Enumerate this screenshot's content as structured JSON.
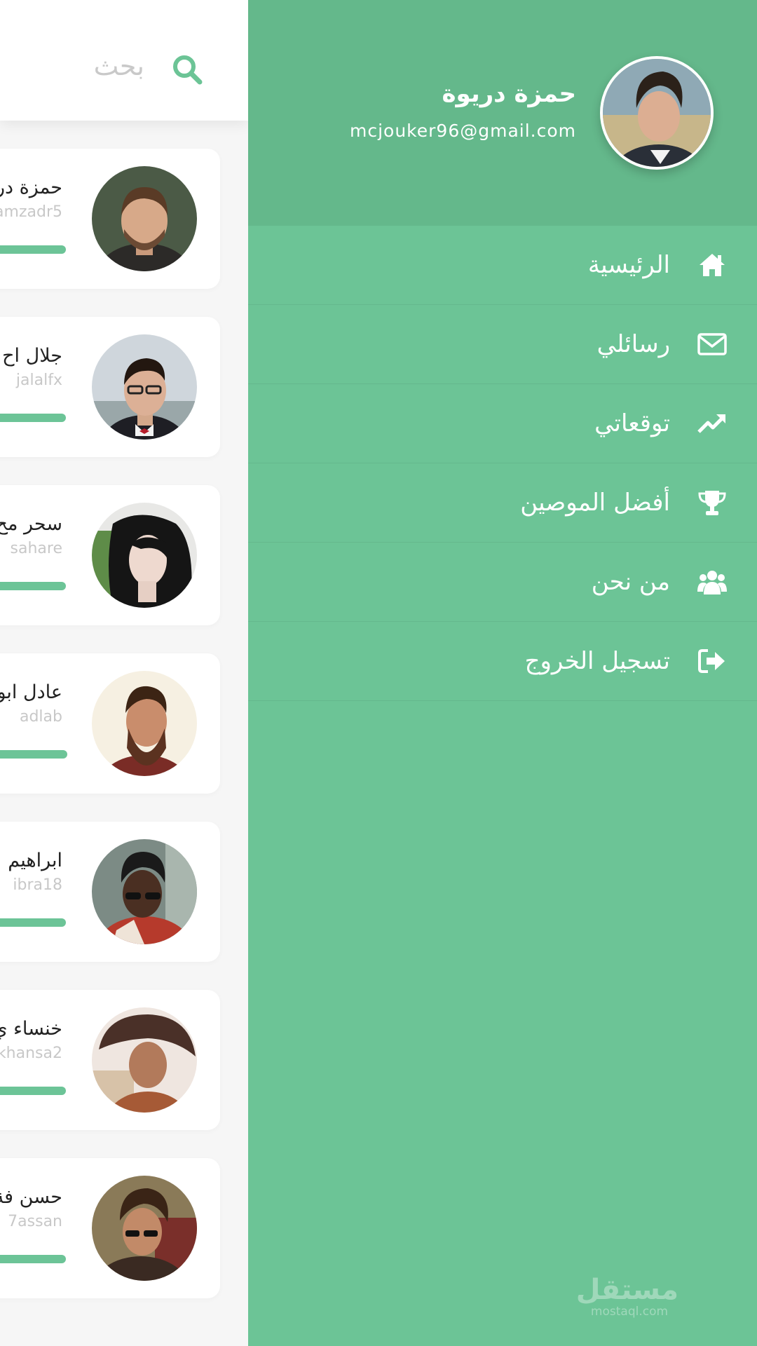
{
  "search": {
    "placeholder": "بحث"
  },
  "users": [
    {
      "name": "حمزة در",
      "handle": "amzadr5",
      "progress": 0.82
    },
    {
      "name": "جلال اح",
      "handle": "jalalfx",
      "progress": 0.82
    },
    {
      "name": "سحر مح",
      "handle": "sahare",
      "progress": 0.82
    },
    {
      "name": "عادل ابو",
      "handle": "adlab",
      "progress": 0.83
    },
    {
      "name": "ابراهيم",
      "handle": "ibra18",
      "progress": 0.82
    },
    {
      "name": "خنساء ي",
      "handle": "khansa2",
      "progress": 0.82
    },
    {
      "name": "حسن فة",
      "handle": "7assan",
      "progress": 0.82
    }
  ],
  "profile": {
    "name": "حمزة دريوة",
    "email": "mcjouker96@gmail.com"
  },
  "menu": [
    {
      "label": "الرئيسية",
      "icon": "home-icon"
    },
    {
      "label": "رسائلي",
      "icon": "envelope-icon"
    },
    {
      "label": "توقعاتي",
      "icon": "trending-up-icon"
    },
    {
      "label": "أفضل الموصين",
      "icon": "trophy-icon"
    },
    {
      "label": "من نحن",
      "icon": "users-icon"
    },
    {
      "label": "تسجيل الخروج",
      "icon": "sign-out-icon"
    }
  ],
  "watermark": {
    "logo": "مستقل",
    "site": "mostaql.com"
  },
  "colors": {
    "accent": "#6cc496",
    "header": "#64b88b",
    "bar": "#6cc497"
  }
}
